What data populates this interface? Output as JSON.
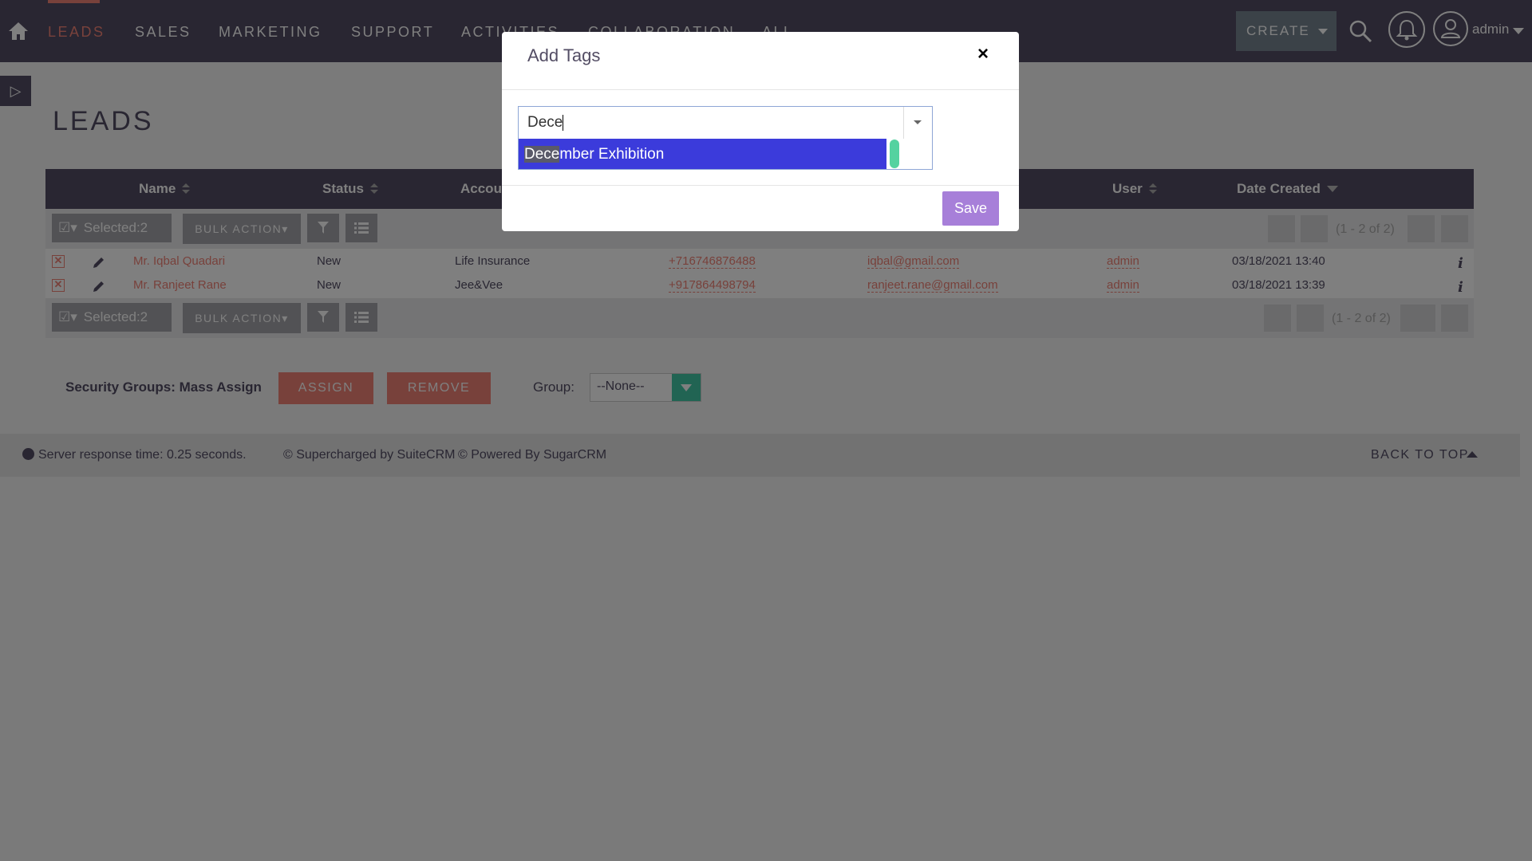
{
  "nav": {
    "items": [
      "LEADS",
      "SALES",
      "MARKETING",
      "SUPPORT",
      "ACTIVITIES",
      "COLLABORATION",
      "ALL"
    ],
    "create_label": "CREATE",
    "user_label": "admin"
  },
  "page": {
    "title": "LEADS"
  },
  "table": {
    "headers": [
      "Name",
      "Status",
      "Accou",
      "User",
      "Date Created"
    ],
    "selected_label": "Selected:2",
    "bulk_action_label": "BULK ACTION",
    "pager_text": "(1 - 2 of 2)",
    "rows": [
      {
        "name": "Mr. Iqbal Quadari",
        "status": "New",
        "account": "Life Insurance",
        "phone": "+716746876488",
        "email": "iqbal@gmail.com",
        "user": "admin",
        "date": "03/18/2021 13:40"
      },
      {
        "name": "Mr. Ranjeet Rane",
        "status": "New",
        "account": "Jee&Vee",
        "phone": "+917864498794",
        "email": "ranjeet.rane@gmail.com",
        "user": "admin",
        "date": "03/18/2021 13:39"
      }
    ]
  },
  "security": {
    "label": "Security Groups: Mass Assign",
    "assign_label": "ASSIGN",
    "remove_label": "REMOVE",
    "group_label": "Group:",
    "group_value": "--None--"
  },
  "footer": {
    "server_time": "Server response time: 0.25 seconds.",
    "supercharged": "© Supercharged by SuiteCRM",
    "powered": "© Powered By SugarCRM",
    "back_to_top": "BACK TO TOP"
  },
  "modal": {
    "title": "Add Tags",
    "close_label": "×",
    "input_value": "Dece",
    "option_match": "Dece",
    "option_rest": "mber Exhibition",
    "save_label": "Save"
  },
  "colors": {
    "nav_bg": "#534d64",
    "accent": "#f08377",
    "save_button": "#a77fd9",
    "dropdown_highlight": "#3b3bdb"
  }
}
